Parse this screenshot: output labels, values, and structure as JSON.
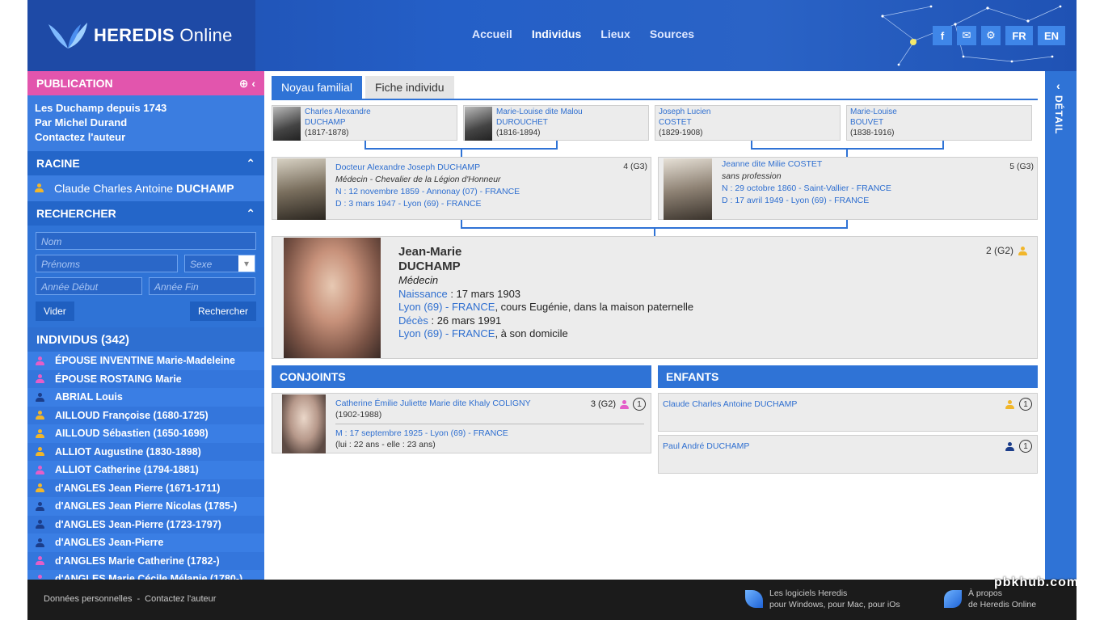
{
  "header": {
    "logo_text": "HEREDIS",
    "logo_text_thin": "Online",
    "nav": [
      "Accueil",
      "Individus",
      "Lieux",
      "Sources"
    ],
    "nav_active": "Individus",
    "lang_fr": "FR",
    "lang_en": "EN",
    "icons": [
      "facebook-icon",
      "mail-icon",
      "gear-icon"
    ]
  },
  "sidebar": {
    "publication_title": "PUBLICATION",
    "publication_lines": [
      "Les Duchamp depuis 1743",
      "Par Michel Durand",
      "Contactez l'auteur"
    ],
    "racine_title": "RACINE",
    "racine_first": "Claude Charles Antoine",
    "racine_last": "DUCHAMP",
    "search_title": "RECHERCHER",
    "search": {
      "nom": "Nom",
      "prenoms": "Prénoms",
      "sexe": "Sexe",
      "annee_debut": "Année Début",
      "annee_fin": "Année Fin",
      "vider": "Vider",
      "rechercher": "Rechercher"
    },
    "individus_title": "INDIVIDUS (342)",
    "individus": [
      {
        "name": "ÉPOUSE INVENTINE Marie-Madeleine",
        "g": "f"
      },
      {
        "name": "ÉPOUSE ROSTAING Marie",
        "g": "f"
      },
      {
        "name": "ABRIAL Louis",
        "g": "m"
      },
      {
        "name": "AILLOUD Françoise (1680-1725)",
        "g": "u"
      },
      {
        "name": "AILLOUD Sébastien (1650-1698)",
        "g": "u"
      },
      {
        "name": "ALLIOT Augustine (1830-1898)",
        "g": "u"
      },
      {
        "name": "ALLIOT Catherine (1794-1881)",
        "g": "f"
      },
      {
        "name": "d'ANGLES Jean Pierre (1671-1711)",
        "g": "u"
      },
      {
        "name": "d'ANGLES Jean Pierre Nicolas (1785-)",
        "g": "m"
      },
      {
        "name": "d'ANGLES Jean-Pierre (1723-1797)",
        "g": "m"
      },
      {
        "name": "d'ANGLES Jean-Pierre",
        "g": "m"
      },
      {
        "name": "d'ANGLES Marie Catherine (1782-)",
        "g": "f"
      },
      {
        "name": "d'ANGLES Marie Cécile Mélanie (1780-)",
        "g": "f"
      }
    ]
  },
  "main": {
    "tabs": [
      "Noyau familial",
      "Fiche individu"
    ],
    "grandparents": [
      {
        "l1": "Charles Alexandre",
        "l2": "DUCHAMP",
        "dates": "(1817-1878)"
      },
      {
        "l1": "Marie-Louise dite Malou",
        "l2": "DUROUCHET",
        "dates": "(1816-1894)"
      },
      {
        "l1": "Joseph Lucien",
        "l2": "COSTET",
        "dates": "(1829-1908)"
      },
      {
        "l1": "Marie-Louise",
        "l2": "BOUVET",
        "dates": "(1838-1916)"
      }
    ],
    "father": {
      "name": "Docteur Alexandre Joseph DUCHAMP",
      "occupation": "Médecin - Chevalier de la Légion d'Honneur",
      "birth": "N : 12 novembre 1859 - Annonay (07) - FRANCE",
      "death": "D : 3 mars 1947 - Lyon (69) - FRANCE",
      "gen": "4 (G3)"
    },
    "mother": {
      "name": "Jeanne dite Milie COSTET",
      "occupation": "sans profession",
      "birth": "N : 29 octobre 1860 - Saint-Vallier - FRANCE",
      "death": "D : 17 avril 1949 - Lyon (69) - FRANCE",
      "gen": "5 (G3)"
    },
    "central": {
      "first": "Jean-Marie",
      "last": "DUCHAMP",
      "occupation": "Médecin",
      "naissance_label": "Naissance",
      "naissance_date": " : 17 mars 1903",
      "naissance_place": "Lyon (69) - FRANCE",
      "naissance_detail": ", cours Eugénie, dans la maison paternelle",
      "deces_label": "Décès",
      "deces_date": " : 26 mars 1991",
      "deces_place": "Lyon (69) - FRANCE",
      "deces_detail": ", à son domicile",
      "gen": "2 (G2)"
    },
    "conjoints_title": "CONJOINTS",
    "enfants_title": "ENFANTS",
    "spouse": {
      "name": "Catherine Émilie Juliette Marie dite Khaly COLIGNY",
      "dates": "(1902-1988)",
      "marriage": "M : 17 septembre 1925 - Lyon (69) - FRANCE",
      "ages": "(lui : 22 ans - elle : 23 ans)",
      "gen": "3 (G2)",
      "count": "1"
    },
    "children": [
      {
        "name": "Claude Charles Antoine DUCHAMP",
        "count": "1",
        "g": "u"
      },
      {
        "name": "Paul André DUCHAMP",
        "count": "1",
        "g": "m"
      }
    ]
  },
  "detail_label": "DÉTAIL",
  "footer": {
    "link1": "Données personnelles",
    "sep": "-",
    "link2": "Contactez l'auteur",
    "promo1_l1": "Les logiciels Heredis",
    "promo1_l2": "pour Windows, pour Mac, pour iOs",
    "promo2_l1": "À propos",
    "promo2_l2": "de Heredis Online",
    "watermark": "pbkhub.com"
  },
  "colors": {
    "accent": "#2f73d6",
    "pink": "#e255ad",
    "female": "#e45ec8",
    "male": "#1b3d8a",
    "unknown": "#f1b62b"
  }
}
